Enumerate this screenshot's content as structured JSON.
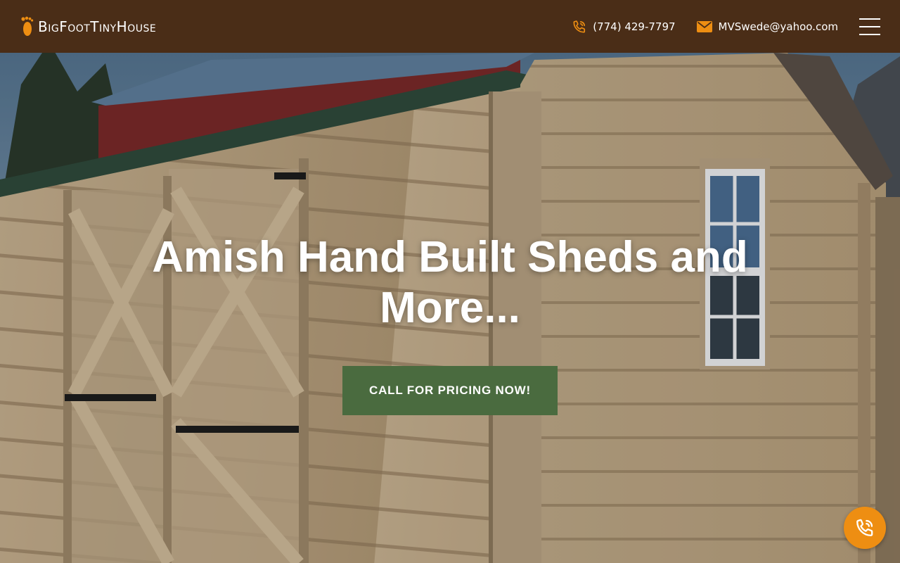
{
  "site": {
    "logo_text": "BigFootTinyHouse",
    "logo_icon": "footprint-icon"
  },
  "header": {
    "phone": "(774) 429-7797",
    "phone_icon": "phone-icon",
    "email": "MVSwede@yahoo.com",
    "email_icon": "envelope-icon",
    "menu_icon": "hamburger-menu-icon"
  },
  "hero": {
    "title": "Amish Hand Built Sheds and More...",
    "cta_label": "CALL FOR PRICING NOW!",
    "background_image": "wooden-shed-photo"
  },
  "floating_call": {
    "icon": "phone-call-icon"
  },
  "colors": {
    "header_bg": "#4a2d17",
    "accent_orange": "#ee8e12",
    "cta_green": "#4a6b3f",
    "text_white": "#ffffff"
  }
}
